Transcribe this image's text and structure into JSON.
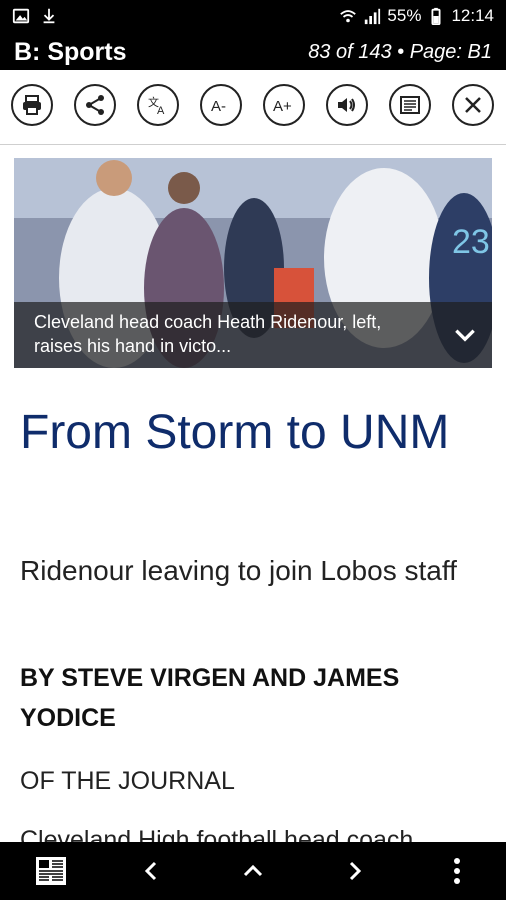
{
  "status_bar": {
    "battery": "55%",
    "time": "12:14"
  },
  "header": {
    "section": "B: Sports",
    "page_info": "83 of 143 • Page: B1"
  },
  "toolbar": {
    "icons": [
      "print-icon",
      "share-icon",
      "translate-icon",
      "font-decrease-icon",
      "font-increase-icon",
      "audio-icon",
      "article-icon",
      "close-icon"
    ]
  },
  "photo": {
    "caption": "Cleveland head coach Heath Ridenour, left, raises his hand in victo..."
  },
  "article": {
    "headline": "From Storm to UNM",
    "subhead": "Ridenour leaving to join Lobos staff",
    "byline": "BY STEVE VIRGEN AND JAMES YODICE",
    "source": "OF THE JOURNAL",
    "body": "Cleveland High football head coach"
  },
  "colors": {
    "headline": "#0f2c6b",
    "bar": "#000000",
    "caption_bg": "#1e1e1e"
  }
}
